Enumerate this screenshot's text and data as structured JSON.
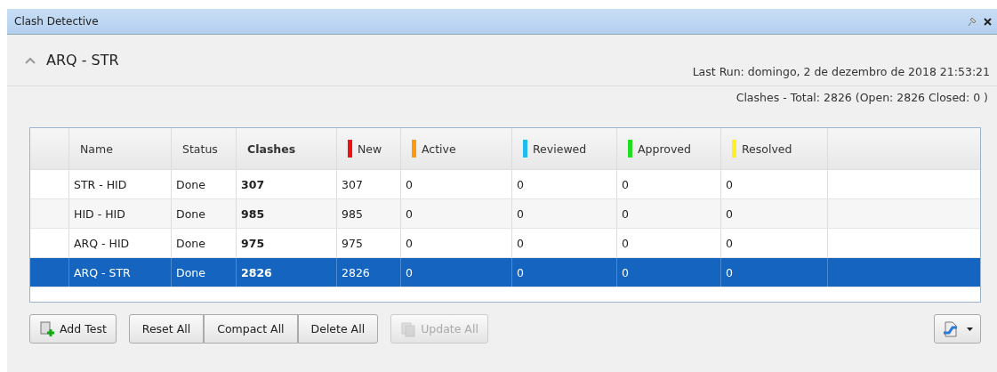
{
  "window": {
    "title": "Clash Detective"
  },
  "test": {
    "name": "ARQ - STR",
    "expanded": true,
    "last_run": "Last Run:  domingo, 2 de dezembro de 2018 21:53:21",
    "summary": "Clashes -  Total:  2826  (Open:  2826  Closed:  0 )"
  },
  "table": {
    "columns": [
      {
        "label": "Name",
        "kind": "plain"
      },
      {
        "label": "Status",
        "kind": "plain"
      },
      {
        "label": "Clashes",
        "kind": "bold"
      },
      {
        "label": "New",
        "kind": "status",
        "color": "#ee1111"
      },
      {
        "label": "Active",
        "kind": "status",
        "color": "#ff9a10"
      },
      {
        "label": "Reviewed",
        "kind": "status",
        "color": "#22bbee"
      },
      {
        "label": "Approved",
        "kind": "status",
        "color": "#22dd22"
      },
      {
        "label": "Resolved",
        "kind": "status",
        "color": "#ffee22"
      }
    ],
    "rows": [
      {
        "cells": [
          "STR - HID",
          "Done",
          "307",
          "307",
          "0",
          "0",
          "0",
          "0"
        ],
        "selected": false
      },
      {
        "cells": [
          "HID - HID",
          "Done",
          "985",
          "985",
          "0",
          "0",
          "0",
          "0"
        ],
        "selected": false
      },
      {
        "cells": [
          "ARQ - HID",
          "Done",
          "975",
          "975",
          "0",
          "0",
          "0",
          "0"
        ],
        "selected": false
      },
      {
        "cells": [
          "ARQ - STR",
          "Done",
          "2826",
          "2826",
          "0",
          "0",
          "0",
          "0"
        ],
        "selected": true
      }
    ]
  },
  "buttons": [
    {
      "label": "Add Test",
      "kind": "add",
      "disabled": false
    },
    {
      "label": "Reset All",
      "kind": "group",
      "disabled": false
    },
    {
      "label": "Compact All",
      "kind": "group",
      "disabled": false
    },
    {
      "label": "Delete All",
      "kind": "group",
      "disabled": false
    },
    {
      "label": "Update All",
      "kind": "update",
      "disabled": true
    }
  ]
}
